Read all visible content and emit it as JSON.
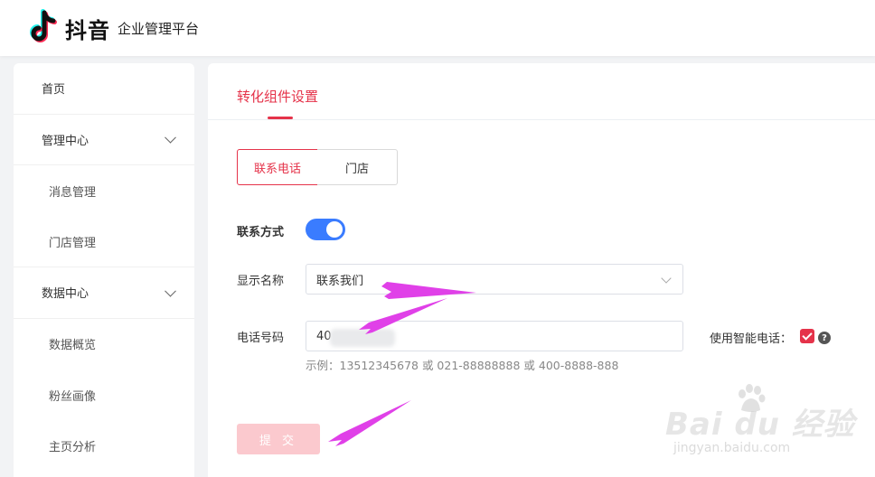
{
  "header": {
    "brand": "抖音",
    "platform": "企业管理平台"
  },
  "sidebar": {
    "items": [
      {
        "label": "首页"
      },
      {
        "label": "管理中心"
      },
      {
        "label": "消息管理"
      },
      {
        "label": "门店管理"
      },
      {
        "label": "数据中心"
      },
      {
        "label": "数据概览"
      },
      {
        "label": "粉丝画像"
      },
      {
        "label": "主页分析"
      }
    ]
  },
  "main": {
    "tab_title": "转化组件设置",
    "segments": {
      "phone": "联系电话",
      "store": "门店"
    },
    "contact_method": {
      "label": "联系方式",
      "enabled": true
    },
    "display_name": {
      "label": "显示名称",
      "value": "联系我们"
    },
    "phone": {
      "label": "电话号码",
      "value": "40",
      "hint": "示例：13512345678 或 021-88888888 或 400-8888-888"
    },
    "smart_phone": {
      "label": "使用智能电话：",
      "checked": true,
      "help": "?"
    },
    "submit_label": "提 交"
  },
  "watermark": {
    "text": "Bai du 经验",
    "sub": "jingyan.baidu.com"
  },
  "colors": {
    "accent": "#e5334a",
    "toggle": "#3a7cff",
    "submit_disabled": "#fbc9ce",
    "annotation_arrow": "#e040e8"
  }
}
